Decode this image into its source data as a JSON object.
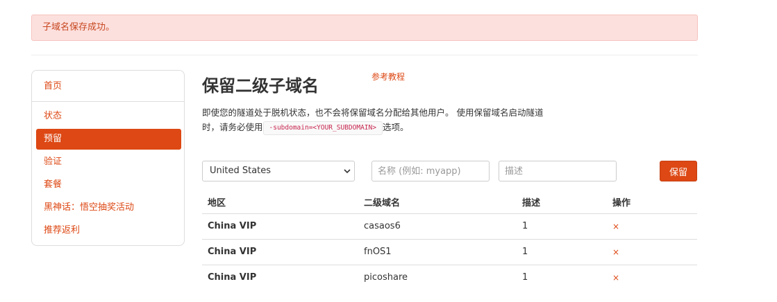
{
  "alert": {
    "message": "子域名保存成功。"
  },
  "sidebar": {
    "items": [
      {
        "label": "首页",
        "active": false
      },
      {
        "label": "状态",
        "active": false
      },
      {
        "label": "预留",
        "active": true
      },
      {
        "label": "验证",
        "active": false
      },
      {
        "label": "套餐",
        "active": false
      },
      {
        "label": "黑神话：悟空抽奖活动",
        "active": false
      },
      {
        "label": "推荐返利",
        "active": false
      }
    ]
  },
  "main": {
    "title": "保留二级子域名",
    "ref_link": "参考教程",
    "desc_line1": "即使您的隧道处于脱机状态，也不会将保留域名分配给其他用户。 使用保留域名启动隧道",
    "desc_line2_prefix": "时，请务必使用",
    "desc_code": "-subdomain=<YOUR_SUBDOMAIN>",
    "desc_line2_suffix": "选项。"
  },
  "form": {
    "region_selected": "United States",
    "name_placeholder": "名称 (例如: myapp)",
    "desc_placeholder": "描述",
    "submit_label": "保留"
  },
  "table": {
    "headers": [
      "地区",
      "二级域名",
      "描述",
      "操作"
    ],
    "rows": [
      {
        "region": "China VIP",
        "subdomain": "casaos6",
        "desc": "1",
        "action": "×"
      },
      {
        "region": "China VIP",
        "subdomain": "fnOS1",
        "desc": "1",
        "action": "×"
      },
      {
        "region": "China VIP",
        "subdomain": "picoshare",
        "desc": "1",
        "action": "×"
      }
    ]
  },
  "colors": {
    "accent": "#dd4814",
    "alert_bg": "#fce0de",
    "alert_text": "#c7461e"
  }
}
